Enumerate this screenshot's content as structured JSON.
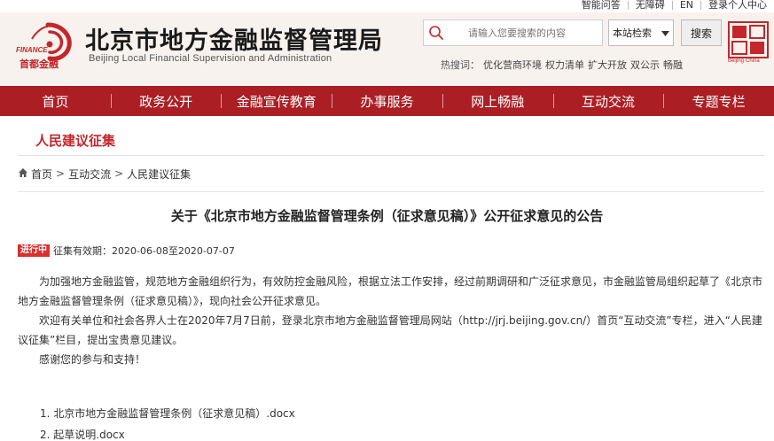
{
  "topbar": {
    "links": [
      "智能问答",
      "无障碍",
      "EN",
      "登录个人中心"
    ]
  },
  "header": {
    "logo_finance": "FINANCE",
    "logo_zh": "首都金融",
    "title": "北京市地方金融监督管理局",
    "subtitle": "Beijing Local Financial Supervision and Administration",
    "search_placeholder": "请输入您要搜索的内容",
    "scope_selected": "本站检索",
    "search_button": "搜索",
    "side_logo_caption": "Beijing·China",
    "hot_label": "热搜词：",
    "hot_words": [
      "优化营商环境",
      "权力清单",
      "扩大开放",
      "双公示",
      "畅融"
    ]
  },
  "nav": {
    "items": [
      "首页",
      "政务公开",
      "金融宣传教育",
      "办事服务",
      "网上畅融",
      "互动交流",
      "专题专栏"
    ]
  },
  "section": {
    "title": "人民建议征集"
  },
  "breadcrumb": {
    "items": [
      "首页",
      "互动交流",
      "人民建议征集"
    ]
  },
  "article": {
    "title": "关于《北京市地方金融监督管理条例（征求意见稿）》公开征求意见的公告",
    "status_badge": "进行中",
    "validity": "征集有效期：2020-06-08至2020-07-07",
    "paragraphs": [
      "为加强地方金融监管，规范地方金融组织行为，有效防控金融风险，根据立法工作安排，经过前期调研和广泛征求意见，市金融监管局组织起草了《北京市地方金融监督管理条例（征求意见稿）》，现向社会公开征求意见。",
      "欢迎有关单位和社会各界人士在2020年7月7日前，登录北京市地方金融监督管理局网站（http://jrj.beijing.gov.cn/）首页“互动交流”专栏，进入“人民建议征集”栏目，提出宝贵意见建议。",
      "感谢您的参与和支持！"
    ],
    "attachments": [
      "1. 北京市地方金融监督管理条例（征求意见稿）.docx",
      "2. 起草说明.docx"
    ]
  },
  "colors": {
    "brand_red": "#ab1f24",
    "accent_red": "#c3272c",
    "header_bg": "#f7f2ee"
  }
}
